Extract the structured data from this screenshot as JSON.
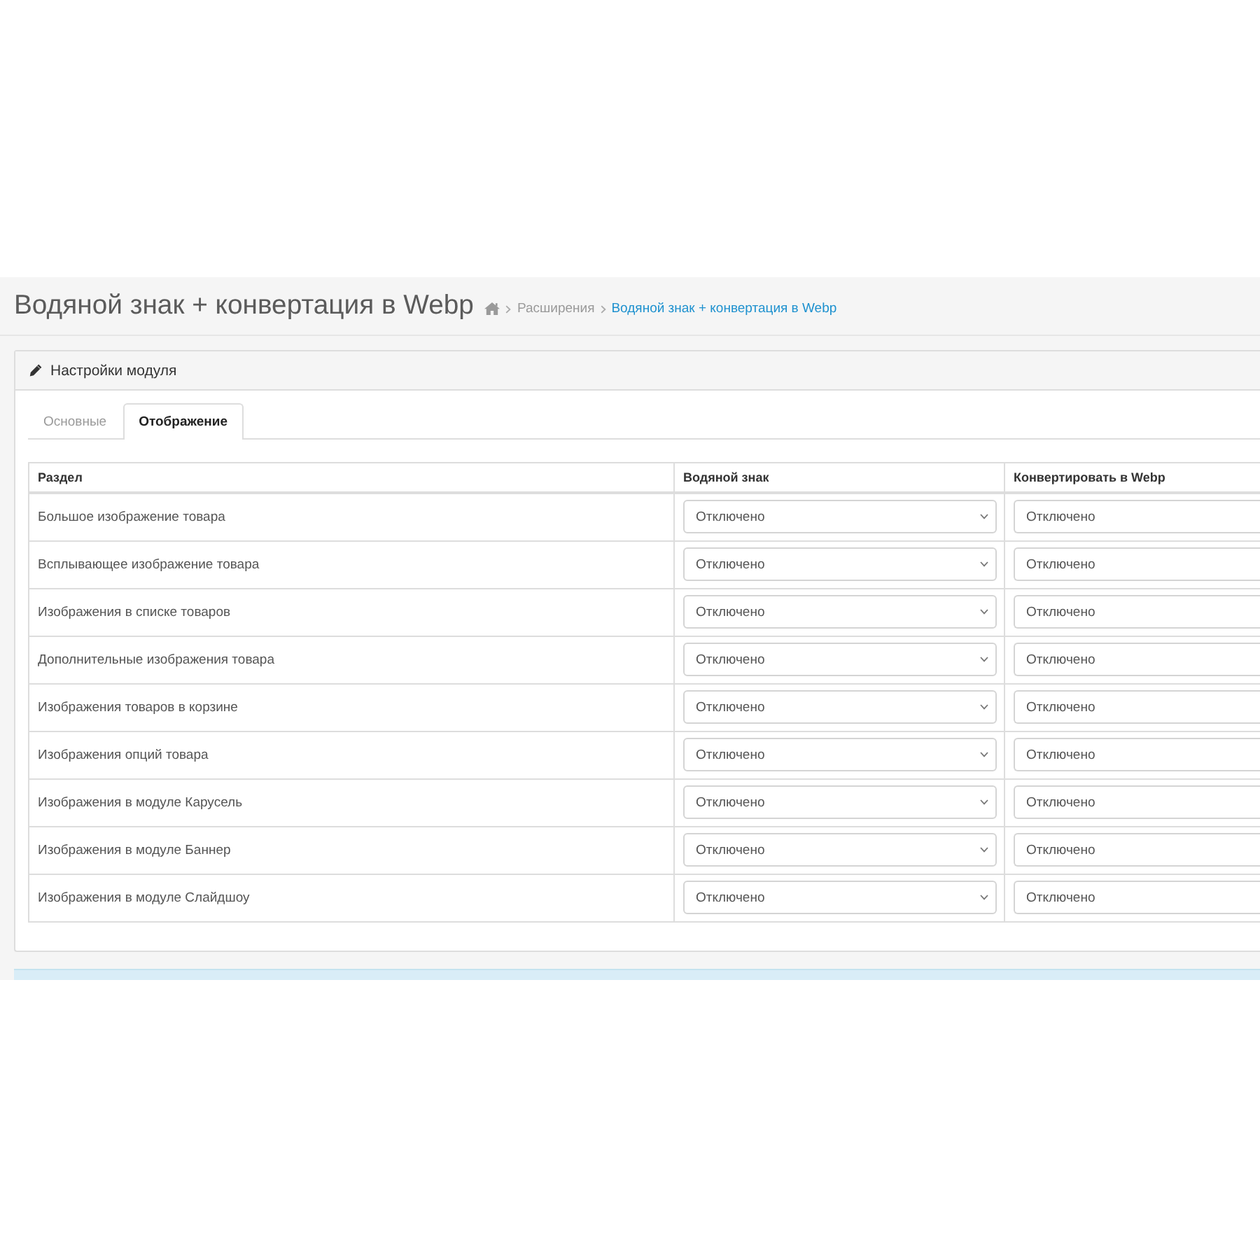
{
  "page_header": {
    "title": "Водяной знак + конвертация в Webp",
    "breadcrumbs": [
      {
        "kind": "home",
        "active": false
      },
      {
        "kind": "link",
        "label": "Расширения",
        "active": false
      },
      {
        "kind": "link",
        "label": "Водяной знак + конвертация в Webp",
        "active": true
      }
    ]
  },
  "panel": {
    "title": "Настройки модуля",
    "tabs": [
      {
        "label": "Основные",
        "selected": false
      },
      {
        "label": "Отображение",
        "selected": true
      }
    ],
    "table": {
      "columns": [
        "Раздел",
        "Водяной знак",
        "Конвертировать в Webp"
      ],
      "rows": [
        {
          "section": "Большое изображение товара",
          "watermark": "Отключено",
          "convert_webp": "Отключено"
        },
        {
          "section": "Всплывающее изображение товара",
          "watermark": "Отключено",
          "convert_webp": "Отключено"
        },
        {
          "section": "Изображения в списке товаров",
          "watermark": "Отключено",
          "convert_webp": "Отключено"
        },
        {
          "section": "Дополнительные изображения товара",
          "watermark": "Отключено",
          "convert_webp": "Отключено"
        },
        {
          "section": "Изображения товаров в корзине",
          "watermark": "Отключено",
          "convert_webp": "Отключено"
        },
        {
          "section": "Изображения опций товара",
          "watermark": "Отключено",
          "convert_webp": "Отключено"
        },
        {
          "section": "Изображения в модуле Карусель",
          "watermark": "Отключено",
          "convert_webp": "Отключено"
        },
        {
          "section": "Изображения в модуле Баннер",
          "watermark": "Отключено",
          "convert_webp": "Отключено"
        },
        {
          "section": "Изображения в модуле Слайдшоу",
          "watermark": "Отключено",
          "convert_webp": "Отключено"
        }
      ]
    }
  }
}
